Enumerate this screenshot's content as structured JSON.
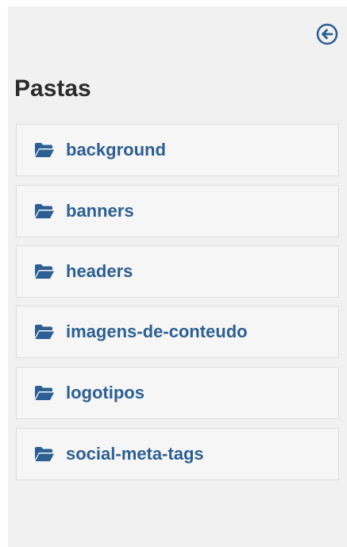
{
  "panel": {
    "back_icon": "circle-arrow-left-icon",
    "title": "Pastas"
  },
  "folders": [
    {
      "label": "background",
      "icon": "folder-open-icon"
    },
    {
      "label": "banners",
      "icon": "folder-open-icon"
    },
    {
      "label": "headers",
      "icon": "folder-open-icon"
    },
    {
      "label": "imagens-de-conteudo",
      "icon": "folder-open-icon"
    },
    {
      "label": "logotipos",
      "icon": "folder-open-icon"
    },
    {
      "label": "social-meta-tags",
      "icon": "folder-open-icon"
    }
  ],
  "colors": {
    "panel_bg": "#f1f1f1",
    "item_bg": "#f6f6f6",
    "item_border": "#dddddd",
    "link": "#2c5f93",
    "title": "#2b2b2b"
  }
}
